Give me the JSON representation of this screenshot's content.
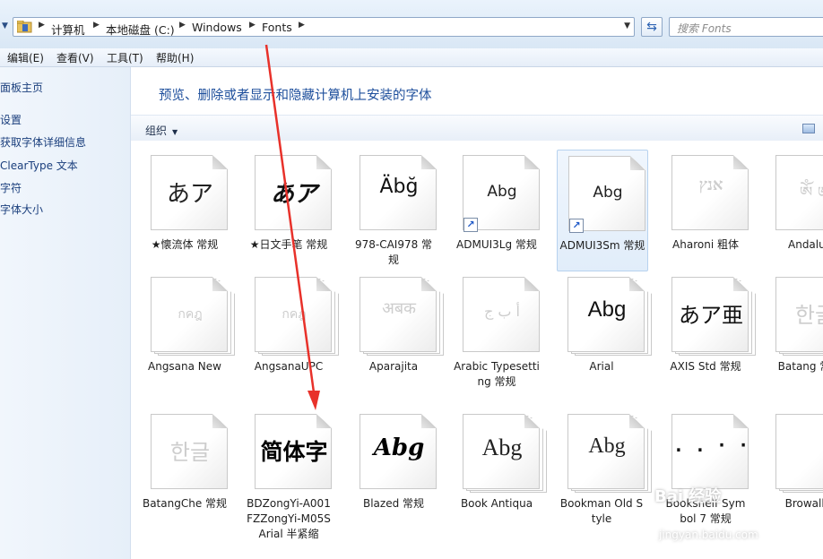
{
  "address_bar": {
    "crumbs": [
      "计算机",
      "本地磁盘 (C:)",
      "Windows",
      "Fonts"
    ],
    "search_placeholder": "搜索 Fonts"
  },
  "menubar": [
    "编辑(E)",
    "查看(V)",
    "工具(T)",
    "帮助(H)"
  ],
  "left_pane": [
    "面板主页",
    "设置",
    "获取字体详细信息",
    "ClearType 文本",
    "字符",
    "字体大小"
  ],
  "main": {
    "title": "预览、删除或者显示和隐藏计算机上安装的字体",
    "organize_label": "组织"
  },
  "fonts": [
    {
      "sample": "あア",
      "label": "★懐流体 常规",
      "style": "single",
      "faded": false
    },
    {
      "sample": "あア",
      "label": "★日文手笔 常规",
      "style": "single",
      "faded": false
    },
    {
      "sample": "Äbğ",
      "label": "978-CAI978 常规",
      "style": "single",
      "faded": false
    },
    {
      "sample": "Abg",
      "label": "ADMUI3Lg 常规",
      "style": "single",
      "faded": false,
      "shortcut": true
    },
    {
      "sample": "Abg",
      "label": "ADMUI3Sm 常规",
      "style": "single",
      "faded": false,
      "shortcut": true,
      "selected": true
    },
    {
      "sample": "אנץ",
      "label": "Aharoni 粗体",
      "style": "single",
      "faded": true
    },
    {
      "sample": "ༀ ༁",
      "label": "Andalus",
      "style": "single",
      "faded": true
    },
    {
      "sample": "กคฎ",
      "label": "Angsana New",
      "style": "stack",
      "faded": true
    },
    {
      "sample": "กคฎ",
      "label": "AngsanaUPC",
      "style": "stack",
      "faded": true
    },
    {
      "sample": "अबक",
      "label": "Aparajita",
      "style": "stack",
      "faded": true
    },
    {
      "sample": "أ ب ج",
      "label": "Arabic Typesetting 常规",
      "style": "single",
      "faded": true
    },
    {
      "sample": "Abg",
      "label": "Arial",
      "style": "stack",
      "faded": false
    },
    {
      "sample": "あア亜",
      "label": "AXIS Std 常规",
      "style": "stack",
      "faded": false
    },
    {
      "sample": "한글",
      "label": "Batang 常规",
      "style": "stack",
      "faded": true
    },
    {
      "sample": "한글",
      "label": "BatangChe 常规",
      "style": "single",
      "faded": true
    },
    {
      "sample": "简体字",
      "label": "BDZongYi-A001 FZZongYi-M05S Arial 半紧缩",
      "style": "single",
      "faded": false
    },
    {
      "sample": "Abg",
      "label": "Blazed 常规",
      "style": "single",
      "faded": false
    },
    {
      "sample": "Abg",
      "label": "Book Antiqua",
      "style": "stack",
      "faded": false
    },
    {
      "sample": "Abg",
      "label": "Bookman Old Style",
      "style": "stack",
      "faded": false
    },
    {
      "sample": ". . ·  ·",
      "label": "Bookshelf Symbol 7 常规",
      "style": "single",
      "faded": false
    },
    {
      "sample": "",
      "label": "Browallia",
      "style": "stack",
      "faded": true
    }
  ],
  "watermark": {
    "brand": "Bai 经验",
    "url": "jingyan.baidu.com"
  }
}
